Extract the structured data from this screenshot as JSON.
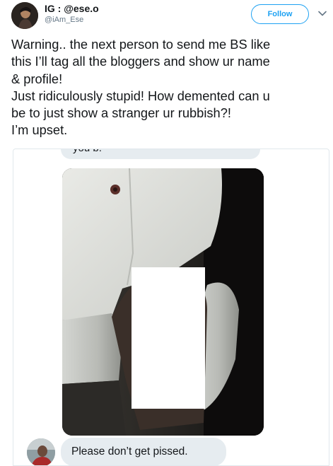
{
  "tweet": {
    "display_name": "IG : @ese.o",
    "handle": "@iAm_Ese",
    "follow_label": "Follow",
    "lines": [
      "Warning.. the next person to send me BS like",
      "this I’ll tag all the bloggers and show ur name",
      "& profile!",
      "Just ridiculously stupid! How demented can u",
      "be to just show a stranger ur rubbish?!",
      "I’m upset."
    ]
  },
  "media": {
    "top_message": "you b.",
    "bottom_message": "Please don’t get pissed."
  },
  "icons": {
    "more": "chevron-down-icon",
    "avatar": "profile-avatar",
    "sender": "sender-avatar"
  },
  "colors": {
    "accent": "#1da1f2",
    "text": "#14171a",
    "muted": "#657786",
    "bubble": "#e6ecf0",
    "border": "#e1e8ed"
  }
}
